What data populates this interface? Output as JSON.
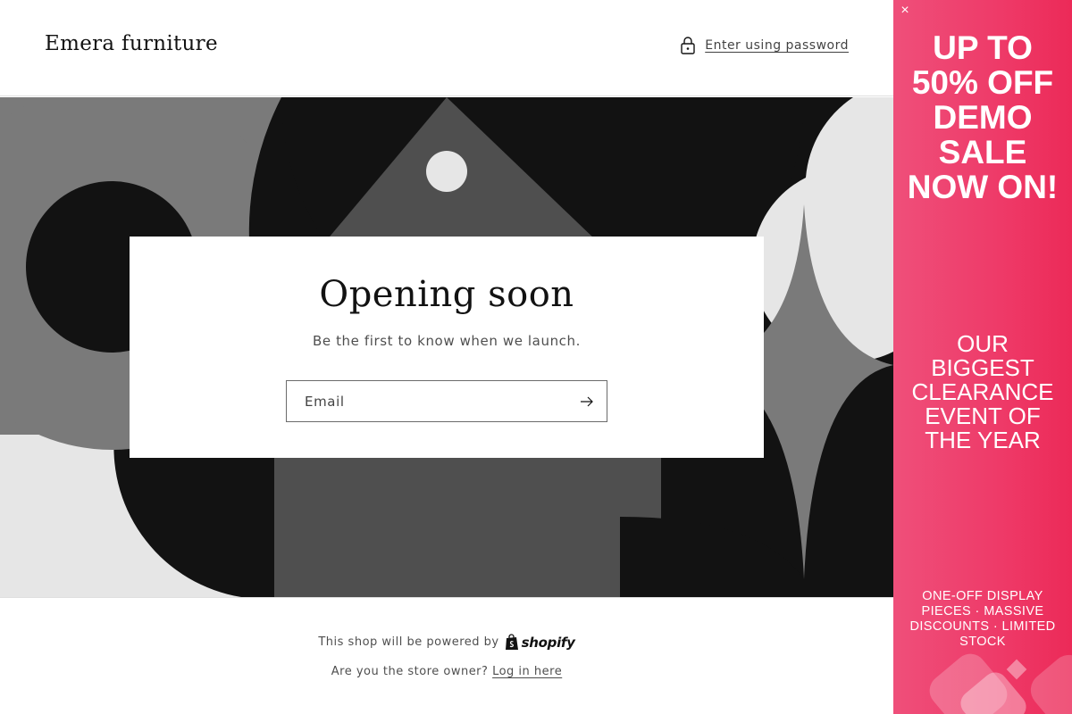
{
  "header": {
    "brand": "Emera furniture",
    "password_link": "Enter using password",
    "lock_icon": "lock-icon"
  },
  "newsletter": {
    "heading": "Opening soon",
    "subheading": "Be the first to know when we launch.",
    "email_placeholder": "Email",
    "submit_icon": "arrow-right-icon"
  },
  "footer": {
    "powered_by": "This shop will be powered by",
    "shopify_wordmark": "shopify",
    "owner_prompt": "Are you the store owner?",
    "login_link": "Log in here"
  },
  "promo": {
    "close_label": "×",
    "headline": "UP TO 50% OFF DEMO SALE NOW ON!",
    "subheadline": "OUR BIGGEST CLEARANCE EVENT OF THE YEAR",
    "detail": "ONE-OFF DISPLAY PIECES · MASSIVE DISCOUNTS · LIMITED STOCK",
    "background_color": "#ee3a68"
  },
  "colors": {
    "text": "#121212",
    "hero_dark": "#121212",
    "hero_mid": "#4f4f4f",
    "hero_gray": "#7a7a7a",
    "hero_light": "#e6e6e6"
  }
}
